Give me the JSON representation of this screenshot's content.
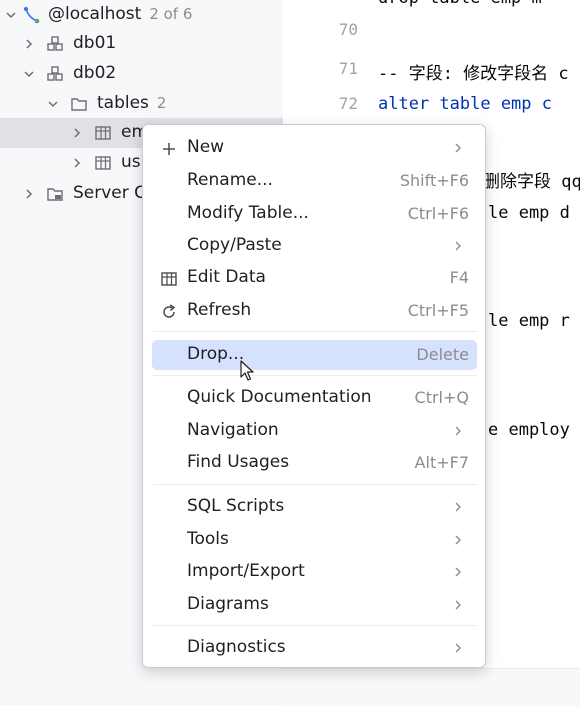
{
  "tree": {
    "localhost": {
      "label": "@localhost",
      "count": "2 of 6"
    },
    "db01": "db01",
    "db02": "db02",
    "tables": {
      "label": "tables",
      "count": "2"
    },
    "table1": "em",
    "table2": "us",
    "server": "Server C"
  },
  "editor": {
    "lines": [
      {
        "num": "70",
        "text": ""
      },
      {
        "num": "71",
        "text": "-- 字段: 修改字段名 c"
      },
      {
        "num": "72",
        "text": "alter table emp c"
      }
    ],
    "top_fragment": "drop table emp m",
    "fragments": {
      "comment2": "删除字段 qq",
      "line_a": "le emp d",
      "line_b": "le emp r",
      "line_c": "e employ"
    }
  },
  "menu": {
    "new": {
      "label": "New"
    },
    "rename": {
      "label": "Rename...",
      "shortcut": "Shift+F6"
    },
    "modify_table": {
      "label": "Modify Table...",
      "shortcut": "Ctrl+F6"
    },
    "copy_paste": {
      "label": "Copy/Paste"
    },
    "edit_data": {
      "label": "Edit Data",
      "shortcut": "F4"
    },
    "refresh": {
      "label": "Refresh",
      "shortcut": "Ctrl+F5"
    },
    "drop": {
      "label": "Drop...",
      "shortcut": "Delete"
    },
    "quick_doc": {
      "label": "Quick Documentation",
      "shortcut": "Ctrl+Q"
    },
    "navigation": {
      "label": "Navigation"
    },
    "find_usages": {
      "label": "Find Usages",
      "shortcut": "Alt+F7"
    },
    "sql_scripts": {
      "label": "SQL Scripts"
    },
    "tools": {
      "label": "Tools"
    },
    "import_export": {
      "label": "Import/Export"
    },
    "diagrams": {
      "label": "Diagrams"
    },
    "diagnostics": {
      "label": "Diagnostics"
    }
  },
  "colors": {
    "menu_highlight": "#d5e1fd",
    "keyword": "#0033b3",
    "comment": "#8c8c8c",
    "tree_selected": "#dfe1e5"
  },
  "icons": [
    "chevron-down-icon",
    "chevron-right-icon",
    "datasource-icon",
    "schema-icon",
    "folder-icon",
    "table-icon",
    "server-folder-icon",
    "plus-icon",
    "refresh-icon",
    "submenu-arrow-icon",
    "mouse-cursor-icon"
  ]
}
